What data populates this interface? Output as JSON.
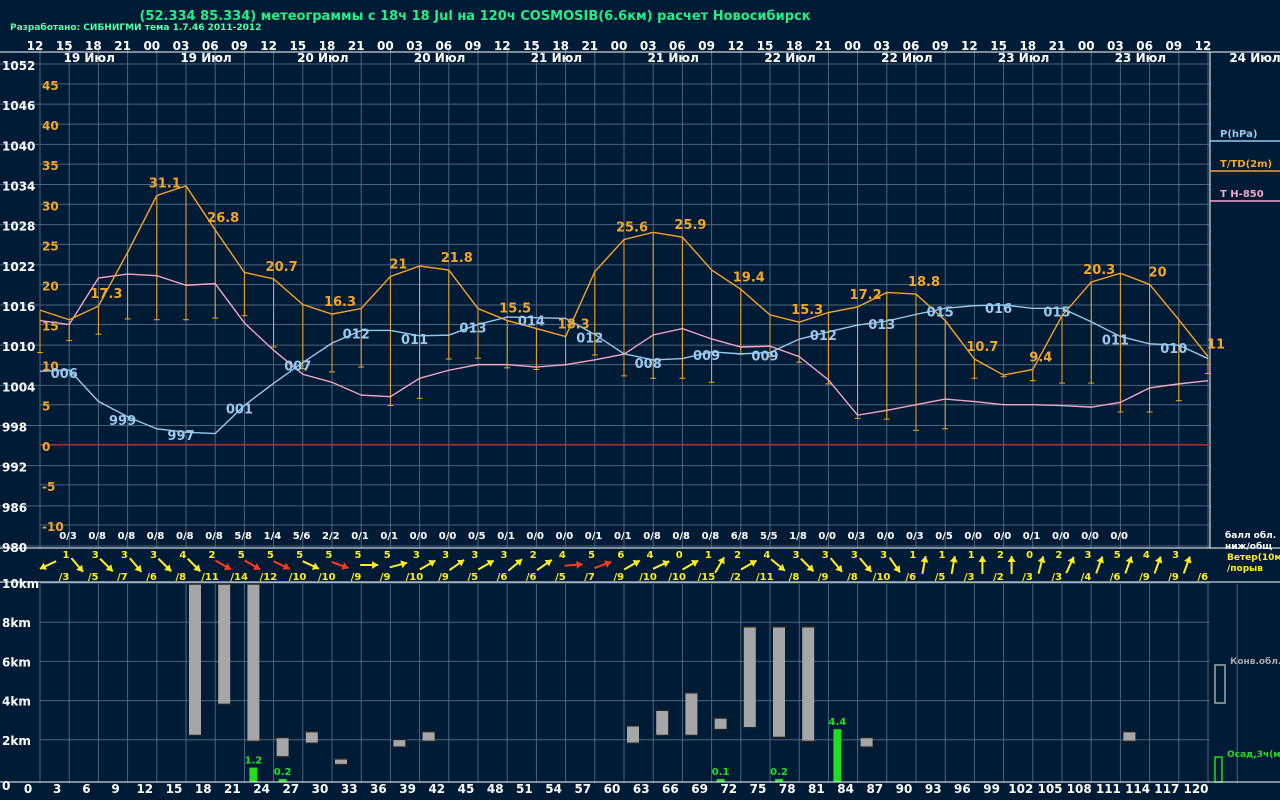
{
  "title": "(52.334 85.334) метеограммы с  18ч 18 Jul на 120ч COSMOSIB(6.6км) расчет Новосибирск",
  "credit": "Разработано: СИБНИГМИ тема 1.7.46 2011-2012",
  "colors": {
    "background": "#001b35",
    "grid": "#4d6680",
    "pressure": "#9cc8ee",
    "temperature": "#f5a623",
    "t850": "#f4a6c6",
    "zero_line": "#a33",
    "wind_arrow": "#ffee22",
    "wind_strong": "#ff3b1a",
    "cloud_bar": "#a6a6a6",
    "precip": "#22dd22",
    "label_text": "#ffffff"
  },
  "hour_labels": [
    "12",
    "15",
    "18",
    "21",
    "00",
    "03",
    "06",
    "09",
    "12",
    "15",
    "18",
    "21",
    "00",
    "03",
    "06",
    "09",
    "12",
    "15",
    "18",
    "21",
    "00",
    "03",
    "06",
    "09",
    "12",
    "15",
    "18",
    "21",
    "00",
    "03",
    "06",
    "09",
    "12",
    "15",
    "18",
    "21",
    "00",
    "03",
    "06",
    "09",
    "12"
  ],
  "date_labels": [
    {
      "label": "19 Июл",
      "step": 1
    },
    {
      "label": "19 Июл",
      "step": 5
    },
    {
      "label": "20 Июл",
      "step": 9
    },
    {
      "label": "20 Июл",
      "step": 13
    },
    {
      "label": "21 Июл",
      "step": 17
    },
    {
      "label": "21 Июл",
      "step": 21
    },
    {
      "label": "22 Июл",
      "step": 25
    },
    {
      "label": "22 Июл",
      "step": 29
    },
    {
      "label": "23 Июл",
      "step": 33
    },
    {
      "label": "23 Июл",
      "step": 37
    },
    {
      "label": "24 Июл",
      "step": 41
    }
  ],
  "pressure_axis_labels": [
    "1052",
    "1046",
    "1040",
    "1034",
    "1028",
    "1022",
    "1016",
    "1010",
    "1004",
    "998",
    "992",
    "986",
    "980"
  ],
  "temp_axis_labels": [
    "45",
    "40",
    "35",
    "30",
    "25",
    "20",
    "15",
    "10",
    "5",
    "0",
    "-5",
    "-10"
  ],
  "legend": {
    "pressure": "P(hPa)",
    "temperature": "T/TD(2m)",
    "t850": "T H-850",
    "cloud_cover": "балл обл.",
    "cloud_cover2": "ниж/общ",
    "wind": "Ветер(10м)",
    "gust": "/порыв",
    "convective": "Конв.обл.",
    "precip": "Осад,3ч(мм)"
  },
  "cloud_cover": [
    "0/3",
    "0/8",
    "0/8",
    "0/8",
    "0/8",
    "0/8",
    "5/8",
    "1/4",
    "5/6",
    "2/2",
    "0/1",
    "0/1",
    "0/0",
    "0/0",
    "0/5",
    "0/1",
    "0/0",
    "0/0",
    "0/1",
    "0/1",
    "0/8",
    "0/8",
    "0/8",
    "6/8",
    "5/5",
    "1/8",
    "0/0",
    "0/3",
    "0/0",
    "0/3",
    "0/5",
    "0/0",
    "0/0",
    "0/1",
    "0/0",
    "0/0",
    "0/0"
  ],
  "wind": {
    "speed": [
      "1",
      "3",
      "3",
      "3",
      "4",
      "2",
      "5",
      "5",
      "5",
      "5",
      "5",
      "5",
      "3",
      "3",
      "3",
      "3",
      "2",
      "4",
      "5",
      "6",
      "4",
      "0",
      "1",
      "2",
      "4",
      "3",
      "3",
      "3",
      "3",
      "1",
      "1",
      "1",
      "2",
      "0",
      "2",
      "3",
      "5",
      "4",
      "3"
    ],
    "gust": [
      "/3",
      "/5",
      "/7",
      "/6",
      "/8",
      "/11",
      "/14",
      "/12",
      "/10",
      "/10",
      "/9",
      "/9",
      "/10",
      "/9",
      "/5",
      "/6",
      "/6",
      "/5",
      "/7",
      "/9",
      "/10",
      "/10",
      "/15",
      "/2",
      "/11",
      "/8",
      "/9",
      "/8",
      "/10",
      "/6",
      "/5",
      "/3",
      "/2",
      "/3",
      "/3",
      "/4",
      "/6",
      "/9",
      "/9",
      "/6"
    ],
    "angle": [
      155,
      50,
      45,
      50,
      45,
      45,
      30,
      30,
      25,
      25,
      20,
      0,
      -15,
      -30,
      -35,
      -30,
      -40,
      -35,
      -5,
      -20,
      -30,
      -25,
      -30,
      -60,
      -30,
      40,
      45,
      50,
      50,
      55,
      -80,
      -80,
      -90,
      -90,
      -75,
      -65,
      -70,
      -70,
      -70,
      -70,
      -70
    ]
  },
  "convective_km_axis": [
    "10km",
    "8km",
    "6km",
    "4km",
    "2km",
    "0"
  ],
  "lead_hours": [
    "3",
    "6",
    "9",
    "12",
    "15",
    "18",
    "21",
    "24",
    "27",
    "30",
    "33",
    "36",
    "39",
    "42",
    "45",
    "48",
    "51",
    "54",
    "57",
    "60",
    "63",
    "66",
    "69",
    "72",
    "75",
    "78",
    "81",
    "84",
    "87",
    "90",
    "93",
    "96",
    "99",
    "102",
    "105",
    "108",
    "111",
    "114",
    "117",
    "120"
  ],
  "precip_labels": [
    {
      "step": 7,
      "value": "1.2"
    },
    {
      "step": 8,
      "value": "0.2"
    },
    {
      "step": 23,
      "value": "0.1"
    },
    {
      "step": 25,
      "value": "0.2"
    },
    {
      "step": 27,
      "value": "4.4"
    }
  ],
  "chart_data": {
    "type": "line",
    "title": "(52.334 85.334) метеограммы с  18ч 18 Jul на 120ч COSMOSIB(6.6км) расчет Новосибирск",
    "x_unit": "lead hours (step 3h)",
    "x": [
      0,
      3,
      6,
      9,
      12,
      15,
      18,
      21,
      24,
      27,
      30,
      33,
      36,
      39,
      42,
      45,
      48,
      51,
      54,
      57,
      60,
      63,
      66,
      69,
      72,
      75,
      78,
      81,
      84,
      87,
      90,
      93,
      96,
      99,
      102,
      105,
      108,
      111,
      114,
      117,
      120
    ],
    "y_left_range": [
      980,
      1052
    ],
    "y_right_range": [
      -10,
      45
    ],
    "grid": true,
    "legend_position": "right",
    "series": [
      {
        "name": "P(hPa)",
        "axis": "pressure",
        "values": [
          1006.1,
          1006.3,
          1001.6,
          999.3,
          997.5,
          997.0,
          996.8,
          1001.0,
          1004.3,
          1007.4,
          1010.3,
          1012.2,
          1012.2,
          1011.4,
          1011.5,
          1013.1,
          1014.2,
          1014.1,
          1014.0,
          1011.6,
          1008.7,
          1007.8,
          1008.0,
          1009.0,
          1008.7,
          1008.9,
          1010.9,
          1012.0,
          1013.0,
          1013.6,
          1014.6,
          1015.5,
          1015.9,
          1016.0,
          1015.5,
          1015.5,
          1013.5,
          1011.3,
          1010.2,
          1010.0,
          1008.0
        ],
        "labels": [
          {
            "step": 1,
            "text": "006"
          },
          {
            "step": 3,
            "text": "999"
          },
          {
            "step": 5,
            "text": "997"
          },
          {
            "step": 7,
            "text": "001"
          },
          {
            "step": 9,
            "text": "007"
          },
          {
            "step": 11,
            "text": "012"
          },
          {
            "step": 13,
            "text": "011"
          },
          {
            "step": 15,
            "text": "013"
          },
          {
            "step": 17,
            "text": "014"
          },
          {
            "step": 19,
            "text": "012"
          },
          {
            "step": 21,
            "text": "008"
          },
          {
            "step": 23,
            "text": "009"
          },
          {
            "step": 25,
            "text": "009"
          },
          {
            "step": 27,
            "text": "012"
          },
          {
            "step": 29,
            "text": "013"
          },
          {
            "step": 31,
            "text": "015"
          },
          {
            "step": 33,
            "text": "016"
          },
          {
            "step": 35,
            "text": "015"
          },
          {
            "step": 37,
            "text": "011"
          },
          {
            "step": 39,
            "text": "010"
          }
        ]
      },
      {
        "name": "T/TD(2m)",
        "axis": "temperature",
        "values": [
          16.8,
          15.6,
          17.3,
          24.0,
          31.1,
          32.3,
          26.8,
          21.5,
          20.7,
          17.5,
          16.3,
          17.0,
          21.0,
          22.3,
          21.8,
          17.0,
          15.5,
          14.5,
          13.5,
          21.6,
          25.6,
          26.5,
          25.9,
          21.8,
          19.4,
          16.2,
          15.3,
          16.5,
          17.2,
          19.0,
          18.8,
          15.5,
          10.7,
          8.7,
          9.4,
          16.1,
          20.3,
          21.4,
          20.0,
          15.6,
          11.0
        ],
        "labels": [
          {
            "step": 2,
            "text": "17.3"
          },
          {
            "step": 4,
            "text": "31.1"
          },
          {
            "step": 6,
            "text": "26.8"
          },
          {
            "step": 8,
            "text": "20.7"
          },
          {
            "step": 10,
            "text": "16.3"
          },
          {
            "step": 12,
            "text": "21"
          },
          {
            "step": 14,
            "text": "21.8"
          },
          {
            "step": 16,
            "text": "15.5"
          },
          {
            "step": 18,
            "text": "18.3"
          },
          {
            "step": 20,
            "text": "25.6"
          },
          {
            "step": 22,
            "text": "25.9"
          },
          {
            "step": 24,
            "text": "19.4"
          },
          {
            "step": 26,
            "text": "15.3"
          },
          {
            "step": 28,
            "text": "17.2"
          },
          {
            "step": 30,
            "text": "18.8"
          },
          {
            "step": 32,
            "text": "10.7"
          },
          {
            "step": 34,
            "text": "9.4"
          },
          {
            "step": 36,
            "text": "20.3"
          },
          {
            "step": 38,
            "text": "20"
          },
          {
            "step": 40,
            "text": "11"
          }
        ],
        "dewpoint_min": [
          11.5,
          13.0,
          13.8,
          15.7,
          15.6,
          15.6,
          15.8,
          16.1,
          12.2,
          9.5,
          9.1,
          9.7,
          4.9,
          5.8,
          10.7,
          10.8,
          9.6,
          9.4,
          10.0,
          11.2,
          8.6,
          8.3,
          8.3,
          7.8,
          11.3,
          11.0,
          10.3,
          7.6,
          3.3,
          3.2,
          1.8,
          2.0,
          8.3,
          8.5,
          8.0,
          7.7,
          7.7,
          4.1,
          4.1,
          5.5,
          8.9
        ]
      },
      {
        "name": "T H-850",
        "axis": "temperature",
        "values": [
          15.5,
          15.0,
          20.8,
          21.3,
          21.1,
          19.9,
          20.1,
          15.2,
          11.8,
          8.8,
          7.8,
          6.2,
          6.0,
          8.3,
          9.3,
          10.0,
          10.0,
          9.7,
          10.0,
          10.6,
          11.3,
          13.7,
          14.5,
          13.2,
          12.2,
          12.3,
          11.0,
          8.1,
          3.7,
          4.3,
          5.0,
          5.7,
          5.4,
          5.0,
          5.0,
          4.9,
          4.7,
          5.3,
          7.1,
          7.6,
          8.0
        ]
      }
    ],
    "cloud_bars": [
      {
        "step": 5,
        "base_km": 2.6,
        "top_km": 10.4
      },
      {
        "step": 6,
        "base_km": 4.2,
        "top_km": 10.4
      },
      {
        "step": 7,
        "base_km": 2.3,
        "top_km": 10.4
      },
      {
        "step": 8,
        "base_km": 1.5,
        "top_km": 2.5
      },
      {
        "step": 9,
        "base_km": 2.2,
        "top_km": 2.8
      },
      {
        "step": 10,
        "base_km": 1.1,
        "top_km": 1.4
      },
      {
        "step": 12,
        "base_km": 2.0,
        "top_km": 2.4
      },
      {
        "step": 13,
        "base_km": 2.3,
        "top_km": 2.8
      },
      {
        "step": 20,
        "base_km": 2.2,
        "top_km": 3.1
      },
      {
        "step": 21,
        "base_km": 2.6,
        "top_km": 3.9
      },
      {
        "step": 22,
        "base_km": 2.6,
        "top_km": 4.8
      },
      {
        "step": 23,
        "base_km": 2.9,
        "top_km": 3.5
      },
      {
        "step": 24,
        "base_km": 3.0,
        "top_km": 8.2
      },
      {
        "step": 25,
        "base_km": 2.5,
        "top_km": 8.2
      },
      {
        "step": 26,
        "base_km": 2.3,
        "top_km": 8.2
      },
      {
        "step": 28,
        "base_km": 2.0,
        "top_km": 2.5
      },
      {
        "step": 37,
        "base_km": 2.3,
        "top_km": 2.8
      }
    ],
    "precip_mm": [
      {
        "step": 7,
        "value": 1.2
      },
      {
        "step": 8,
        "value": 0.2
      },
      {
        "step": 23,
        "value": 0.1
      },
      {
        "step": 25,
        "value": 0.2
      },
      {
        "step": 27,
        "value": 4.4
      }
    ]
  }
}
